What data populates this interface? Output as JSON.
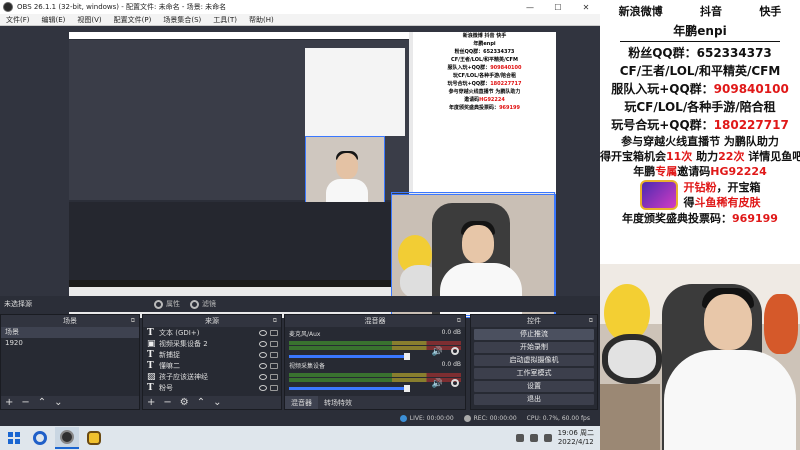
{
  "window": {
    "title": "OBS 26.1.1 (32-bit, windows) - 配置文件: 未命名 - 场景: 未命名",
    "min": "—",
    "max": "☐",
    "close": "✕"
  },
  "menu": [
    "文件(F)",
    "编辑(E)",
    "视图(V)",
    "配置文件(P)",
    "场景集合(S)",
    "工具(T)",
    "帮助(H)"
  ],
  "source_bar": {
    "no_selection": "未选择源",
    "properties": "属性",
    "filters": "滤镜"
  },
  "scenes": {
    "title": "场景",
    "items": [
      "场景",
      "1920"
    ],
    "selected": 0
  },
  "sources": {
    "title": "来源",
    "items": [
      "文本 (GDI+)",
      "视频采集设备 2",
      "新捕捉",
      "懂嘛二",
      "孩子应该送神经",
      "粉号"
    ]
  },
  "mixer": {
    "title": "混音器",
    "channels": [
      {
        "name": "麦克风/Aux",
        "db": "0.0 dB"
      },
      {
        "name": "视频采集设备",
        "db": "0.0 dB"
      }
    ],
    "tabs": [
      "混音器",
      "转场特效"
    ]
  },
  "controls": {
    "title": "控件",
    "buttons": [
      "停止推流",
      "开始录制",
      "启动虚拟摄像机",
      "工作室模式",
      "设置",
      "退出"
    ]
  },
  "status": {
    "live": "LIVE: 00:00:00",
    "rec": "REC: 00:00:00",
    "cpu": "CPU: 0.7%, 60.00 fps"
  },
  "taskbar": {
    "time": "19:06 周二",
    "date": "2022/4/12"
  },
  "overlay": {
    "socials": [
      "新浪微博",
      "抖音",
      "快手"
    ],
    "nickname": "年鹏enpi",
    "fan_qq_label": "粉丝QQ群：",
    "fan_qq": "652334373",
    "games": "CF/王者/LOL/和平精英/CFM",
    "join_label": "服队入玩+QQ群：",
    "join_qq": "909840100",
    "play_label": "玩CF/LOL/各种手游/陪合租",
    "play_qq_label": "玩号合玩+QQ群：",
    "play_qq": "180227717",
    "event_line1": "参与穿越火线直播节 为鹏队助力",
    "event_line2_a": "得开宝箱机会",
    "event_line2_b": "11次",
    "event_line2_c": " 助力",
    "event_line2_d": "22次",
    "event_line2_e": " 详情见鱼吧",
    "invite_label": "年鹏",
    "invite_mid": "专属",
    "invite_code_label": "邀请码",
    "invite_code": "HG92224",
    "badge_line1_a": "开钻粉",
    "badge_line1_b": "，开宝箱",
    "badge_line2_a": "得",
    "badge_line2_b": "斗鱼稀有皮肤",
    "vote_label": "年度颁奖盛典投票码：",
    "vote_code": "969199"
  },
  "colors": {
    "accent_blue": "#3a78ff",
    "highlight_red": "#e01818",
    "obs_bg": "#2b2e38"
  }
}
